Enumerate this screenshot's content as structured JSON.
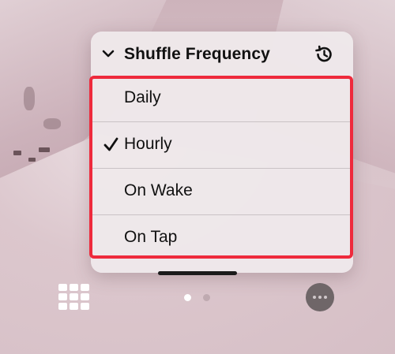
{
  "menu": {
    "header": {
      "title": "Shuffle Frequency",
      "icons": [
        "chevron-down-icon",
        "history-icon"
      ]
    },
    "options": [
      {
        "label": "Daily",
        "selected": false
      },
      {
        "label": "Hourly",
        "selected": true
      },
      {
        "label": "On Wake",
        "selected": false
      },
      {
        "label": "On Tap",
        "selected": false
      }
    ]
  },
  "bottom_bar": {
    "left_icon": "grid-icon",
    "page_indicator": {
      "pages": 2,
      "current": 1
    },
    "right_icon": "more-icon"
  },
  "colors": {
    "highlight": "#ee2a3c",
    "menu_background": "#eee8ea",
    "text": "#111111"
  }
}
